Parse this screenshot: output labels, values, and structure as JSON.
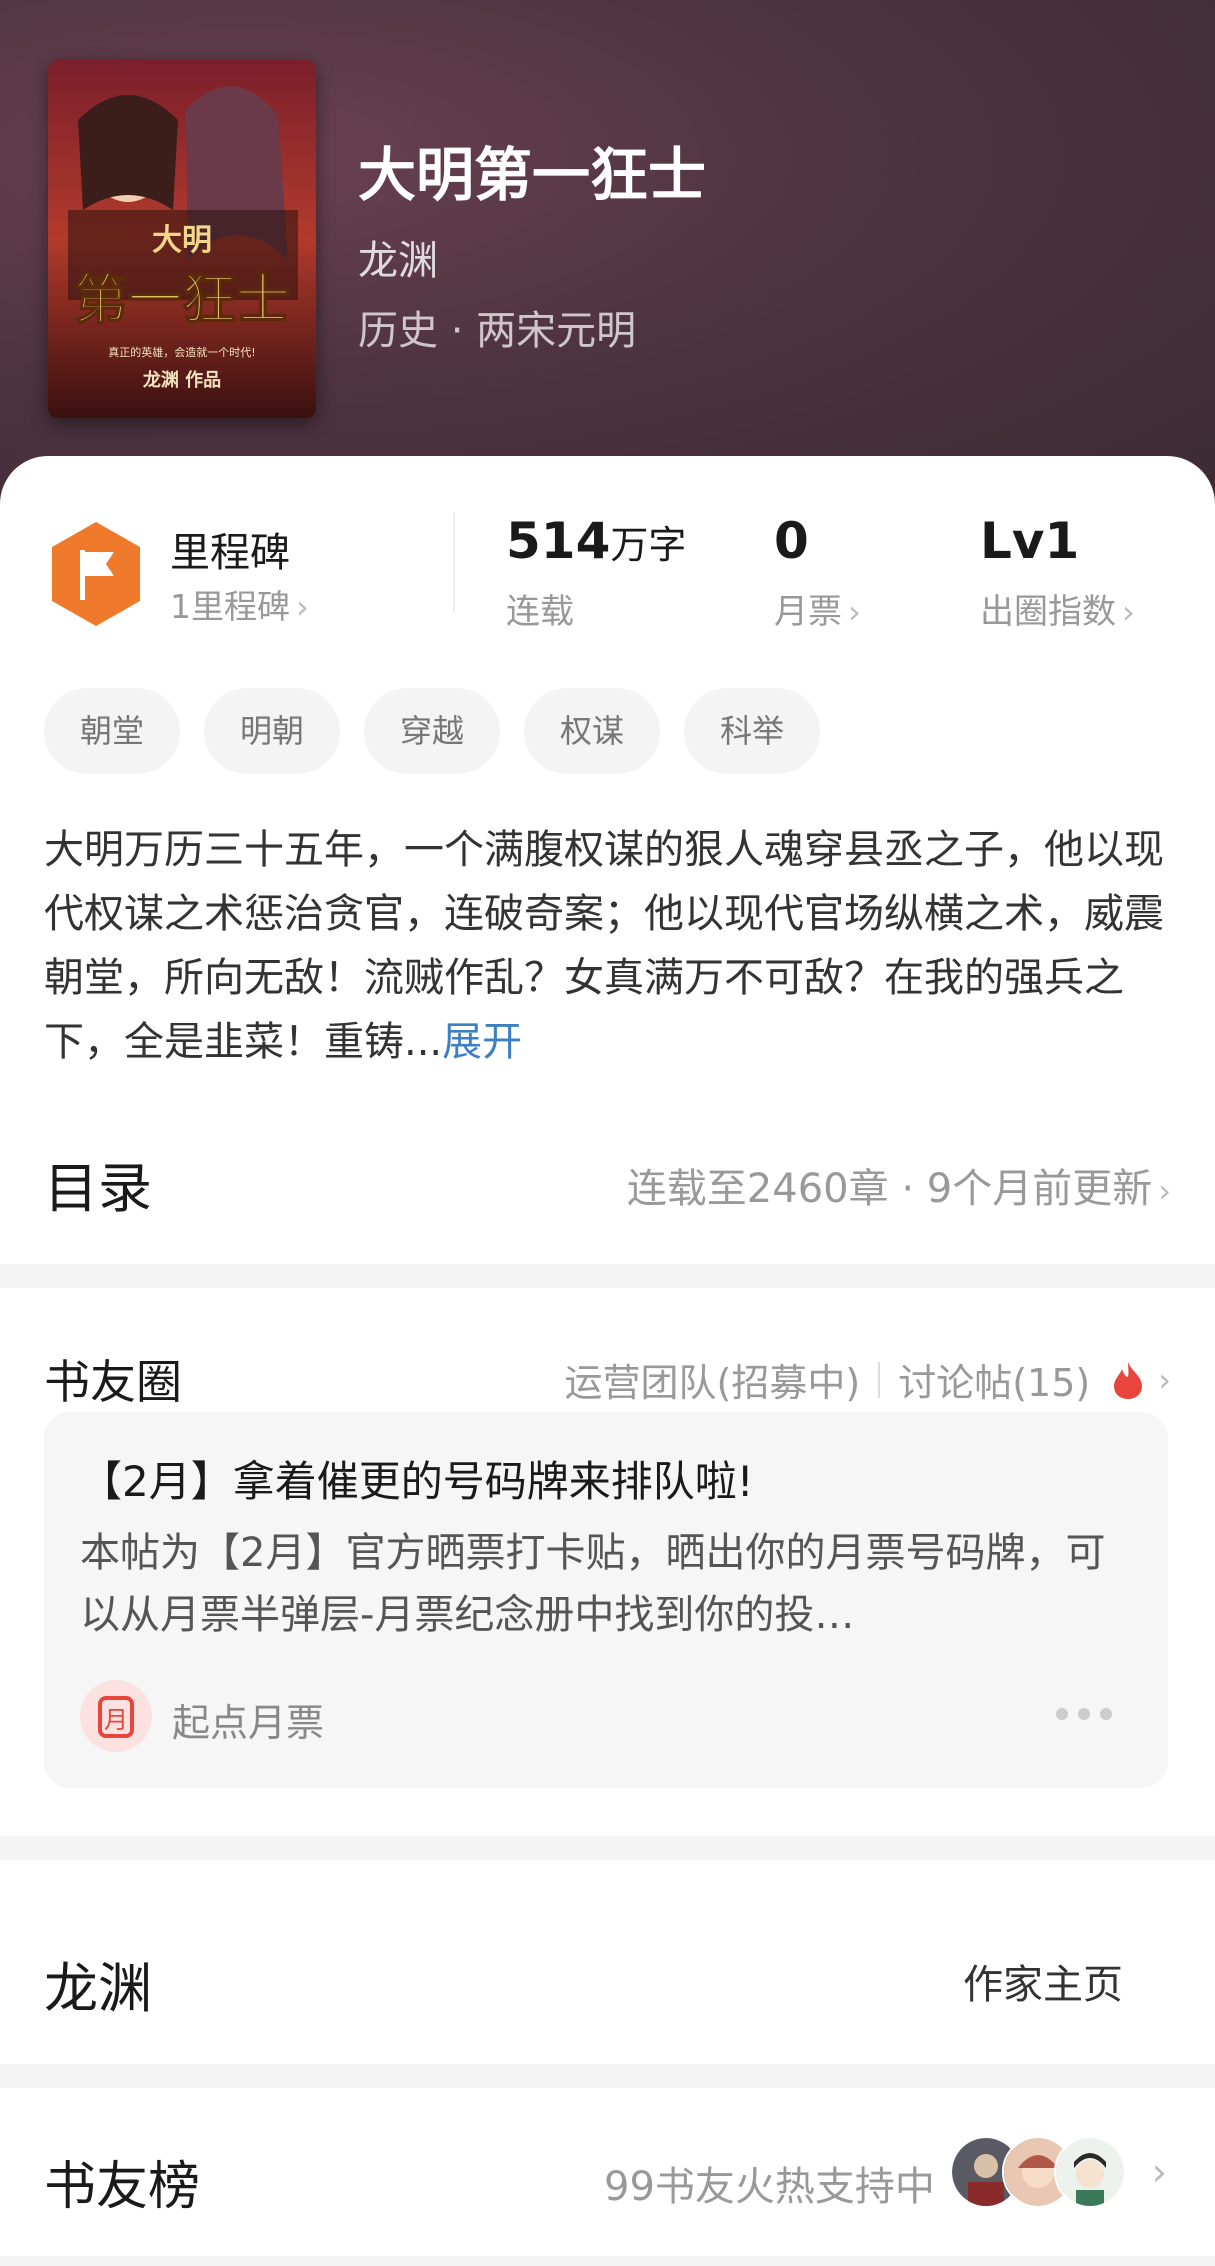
{
  "header": {
    "title": "大明第一狂士",
    "author": "龙渊",
    "genre": "历史 · 两宋元明",
    "cover_text": {
      "top": "大明",
      "big": "第一狂士",
      "tagline": "真正的英雄，会造就一个时代!",
      "credit": "龙渊 作品"
    }
  },
  "stats": {
    "milestone_title": "里程碑",
    "milestone_sub": "1里程碑",
    "words_value": "514",
    "words_unit": "万字",
    "words_label": "连载",
    "tickets_value": "0",
    "tickets_label": "月票",
    "level_value": "Lv1",
    "level_label": "出圈指数"
  },
  "tags": [
    "朝堂",
    "明朝",
    "穿越",
    "权谋",
    "科举"
  ],
  "synopsis": {
    "text": "大明万历三十五年，一个满腹权谋的狠人魂穿县丞之子，他以现代权谋之术惩治贪官，连破奇案；他以现代官场纵横之术，威震朝堂，所向无敌！流贼作乱？女真满万不可敌？在我的强兵之下，全是韭菜！重铸...",
    "expand_label": "展开"
  },
  "toc": {
    "title": "目录",
    "meta": "连载至2460章 · 9个月前更新"
  },
  "book_circle": {
    "title": "书友圈",
    "team": "运营团队(招募中)",
    "posts_link": "讨论帖(15)",
    "post": {
      "title": "【2月】拿着催更的号码牌来排队啦!",
      "body": "本帖为【2月】官方晒票打卡贴，晒出你的月票号码牌，可以从月票半弹层-月票纪念册中找到你的投…",
      "author": "起点月票",
      "avatar_char": "月"
    }
  },
  "author_section": {
    "name": "龙渊",
    "link": "作家主页"
  },
  "ranking": {
    "title": "书友榜",
    "meta": "99书友火热支持中"
  },
  "colors": {
    "accent_orange": "#f07a2c",
    "link_blue": "#3d7fc3",
    "fire_red": "#e8453c"
  }
}
